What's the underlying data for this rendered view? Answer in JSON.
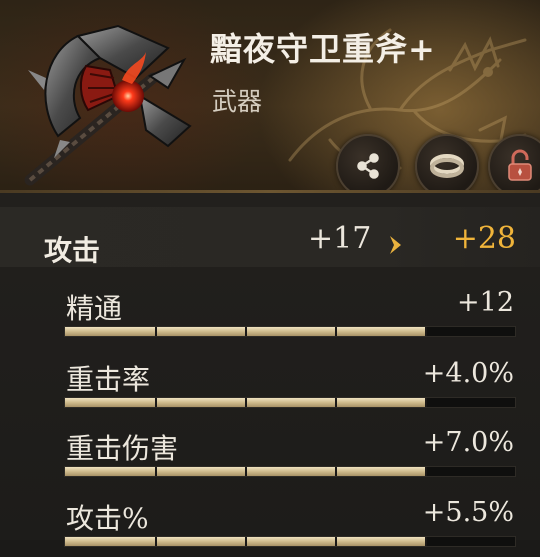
{
  "item": {
    "name": "黯夜守卫重斧+",
    "type": "武器",
    "icon": "battle-axe-icon"
  },
  "actions": [
    {
      "icon": "share-icon"
    },
    {
      "icon": "ring-icon"
    },
    {
      "icon": "lock-icon"
    }
  ],
  "attack": {
    "label": "攻击",
    "current": "+17",
    "new": "+28",
    "new_color": "#f0b43a"
  },
  "substats": [
    {
      "label": "精通",
      "value": "+12",
      "fill": 0.8
    },
    {
      "label": "重击率",
      "value": "+4.0%",
      "fill": 0.8
    },
    {
      "label": "重击伤害",
      "value": "+7.0%",
      "fill": 0.8
    },
    {
      "label": "攻击%",
      "value": "+5.5%",
      "fill": 0.8
    }
  ]
}
